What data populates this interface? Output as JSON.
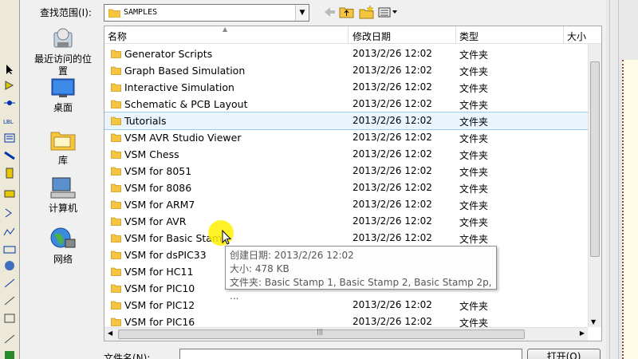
{
  "dialog": {
    "lookin_label": "查找范围(I):",
    "lookin_value": "SAMPLES",
    "filename_label": "文件名(N):",
    "filename_value": "",
    "open_button": "打开(O)"
  },
  "places": [
    {
      "label": "最近访问的位置",
      "icon": "recent-places-icon"
    },
    {
      "label": "桌面",
      "icon": "desktop-icon"
    },
    {
      "label": "库",
      "icon": "libraries-icon"
    },
    {
      "label": "计算机",
      "icon": "computer-icon"
    },
    {
      "label": "网络",
      "icon": "network-icon"
    }
  ],
  "columns": {
    "name": "名称",
    "date": "修改日期",
    "type": "类型",
    "size": "大小"
  },
  "files": [
    {
      "name": "Generator Scripts",
      "date": "2013/2/26 12:02",
      "type": "文件夹"
    },
    {
      "name": "Graph Based Simulation",
      "date": "2013/2/26 12:02",
      "type": "文件夹"
    },
    {
      "name": "Interactive Simulation",
      "date": "2013/2/26 12:02",
      "type": "文件夹"
    },
    {
      "name": "Schematic & PCB Layout",
      "date": "2013/2/26 12:02",
      "type": "文件夹"
    },
    {
      "name": "Tutorials",
      "date": "2013/2/26 12:02",
      "type": "文件夹"
    },
    {
      "name": "VSM AVR Studio Viewer",
      "date": "2013/2/26 12:02",
      "type": "文件夹"
    },
    {
      "name": "VSM Chess",
      "date": "2013/2/26 12:02",
      "type": "文件夹"
    },
    {
      "name": "VSM for 8051",
      "date": "2013/2/26 12:02",
      "type": "文件夹"
    },
    {
      "name": "VSM for 8086",
      "date": "2013/2/26 12:02",
      "type": "文件夹"
    },
    {
      "name": "VSM for ARM7",
      "date": "2013/2/26 12:02",
      "type": "文件夹"
    },
    {
      "name": "VSM for AVR",
      "date": "2013/2/26 12:02",
      "type": "文件夹"
    },
    {
      "name": "VSM for Basic Stamp",
      "date": "2013/2/26 12:02",
      "type": "文件夹"
    },
    {
      "name": "VSM for dsPIC33",
      "date": "",
      "type": ""
    },
    {
      "name": "VSM for HC11",
      "date": "",
      "type": ""
    },
    {
      "name": "VSM for PIC10",
      "date": "",
      "type": ""
    },
    {
      "name": "VSM for PIC12",
      "date": "2013/2/26 12:02",
      "type": "文件夹"
    },
    {
      "name": "VSM for PIC16",
      "date": "2013/2/26 12:02",
      "type": "文件夹"
    }
  ],
  "tooltip": {
    "line1": "创建日期: 2013/2/26 12:02",
    "line2": "大小: 478 KB",
    "line3": "文件夹: Basic Stamp 1, Basic Stamp 2, Basic Stamp 2p, ..."
  },
  "colors": {
    "folder": "#f5c542",
    "selection": "#eaf4fd",
    "cursor_highlight": "#fff000"
  }
}
